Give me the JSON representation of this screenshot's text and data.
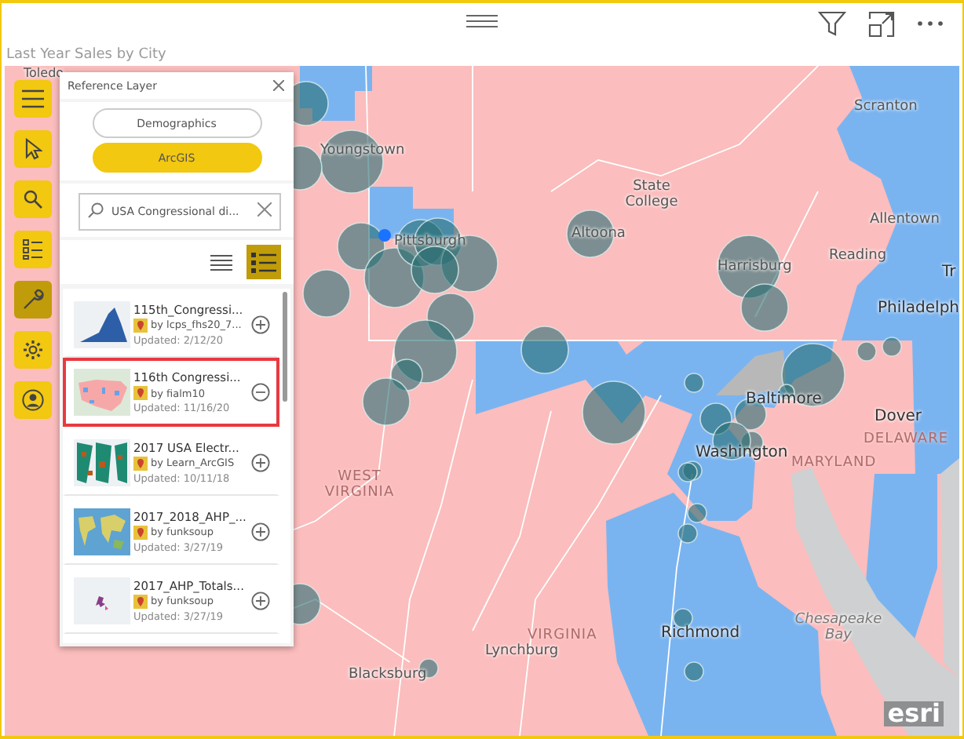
{
  "visual": {
    "title": "Last Year Sales by City"
  },
  "toolbar": [
    {
      "kind": "menu",
      "selected": false
    },
    {
      "kind": "pointer",
      "selected": false
    },
    {
      "kind": "search",
      "selected": false
    },
    {
      "kind": "layers",
      "selected": false
    },
    {
      "kind": "wrench",
      "selected": true
    },
    {
      "kind": "gear",
      "selected": false
    },
    {
      "kind": "person",
      "selected": false
    }
  ],
  "reference_panel": {
    "title": "Reference Layer",
    "sources": [
      {
        "label": "Demographics",
        "selected": false
      },
      {
        "label": "ArcGIS",
        "selected": true
      }
    ],
    "search": {
      "value": "USA Congressional di..."
    },
    "views": [
      {
        "kind": "compact",
        "selected": false
      },
      {
        "kind": "detailed",
        "selected": true
      }
    ],
    "layers": [
      {
        "title": "115th_Congressi...",
        "author": "by lcps_fhs20_7...",
        "updated": "Updated: 2/12/20",
        "added": false,
        "selected": false
      },
      {
        "title": "116th Congressi...",
        "author": "by fialm10",
        "updated": "Updated: 11/16/20",
        "added": true,
        "selected": true
      },
      {
        "title": "2017 USA Electr...",
        "author": "by Learn_ArcGIS",
        "updated": "Updated: 10/11/18",
        "added": false,
        "selected": false
      },
      {
        "title": "2017_2018_AHP_...",
        "author": "by funksoup",
        "updated": "Updated: 3/27/19",
        "added": false,
        "selected": false
      },
      {
        "title": "2017_AHP_Totals...",
        "author": "by funksoup",
        "updated": "Updated: 3/27/19",
        "added": false,
        "selected": false
      }
    ]
  },
  "map": {
    "labels": [
      {
        "text": "Toledo",
        "kind": "city"
      },
      {
        "text": "Scranton",
        "kind": "city"
      },
      {
        "text": "Youngstown",
        "kind": "city"
      },
      {
        "text": "State College",
        "kind": "city"
      },
      {
        "text": "Allentown",
        "kind": "city"
      },
      {
        "text": "Altoona",
        "kind": "city"
      },
      {
        "text": "Pittsburgh",
        "kind": "city"
      },
      {
        "text": "Reading",
        "kind": "city"
      },
      {
        "text": "Harrisburg",
        "kind": "city"
      },
      {
        "text": "Tr",
        "kind": "major"
      },
      {
        "text": "Philadelph",
        "kind": "major"
      },
      {
        "text": "Baltimore",
        "kind": "major"
      },
      {
        "text": "Dover",
        "kind": "major"
      },
      {
        "text": "DELAWARE",
        "kind": "state"
      },
      {
        "text": "Washington",
        "kind": "major"
      },
      {
        "text": "MARYLAND",
        "kind": "state"
      },
      {
        "text": "WEST VIRGINIA",
        "kind": "state"
      },
      {
        "text": "VIRGINIA",
        "kind": "state"
      },
      {
        "text": "Richmond",
        "kind": "major"
      },
      {
        "text": "Chesapeake Bay",
        "kind": "water"
      },
      {
        "text": "Lynchburg",
        "kind": "city"
      },
      {
        "text": "Blacksburg",
        "kind": "city"
      }
    ],
    "attribution": "esri"
  }
}
